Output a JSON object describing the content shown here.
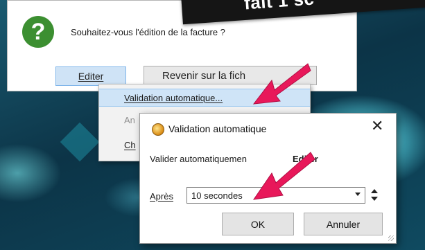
{
  "banner": {
    "text": "fait 1 sc"
  },
  "back_dialog": {
    "question": "Souhaitez-vous l'édition de la facture ?",
    "editer_label": "Editer",
    "revenir_label": "Revenir sur la fich"
  },
  "context_menu": {
    "items": [
      {
        "label": "Validation automatique..."
      },
      {
        "label": "An"
      },
      {
        "label": "Ch"
      }
    ]
  },
  "dialog": {
    "title": "Validation automatique",
    "close_glyph": "✕",
    "description": "Valider automatiquemen",
    "description_fragment": "Editer",
    "apres_label": "Après",
    "delay_value": "10 secondes",
    "ok_label": "OK",
    "cancel_label": "Annuler"
  },
  "icons": {
    "question": "question-icon",
    "app": "gear-coin-icon",
    "arrow_color": "#e8185a"
  },
  "colors": {
    "question_icon": "#3c8f31",
    "highlight": "#cfe4f7",
    "arrow": "#e8185a"
  }
}
